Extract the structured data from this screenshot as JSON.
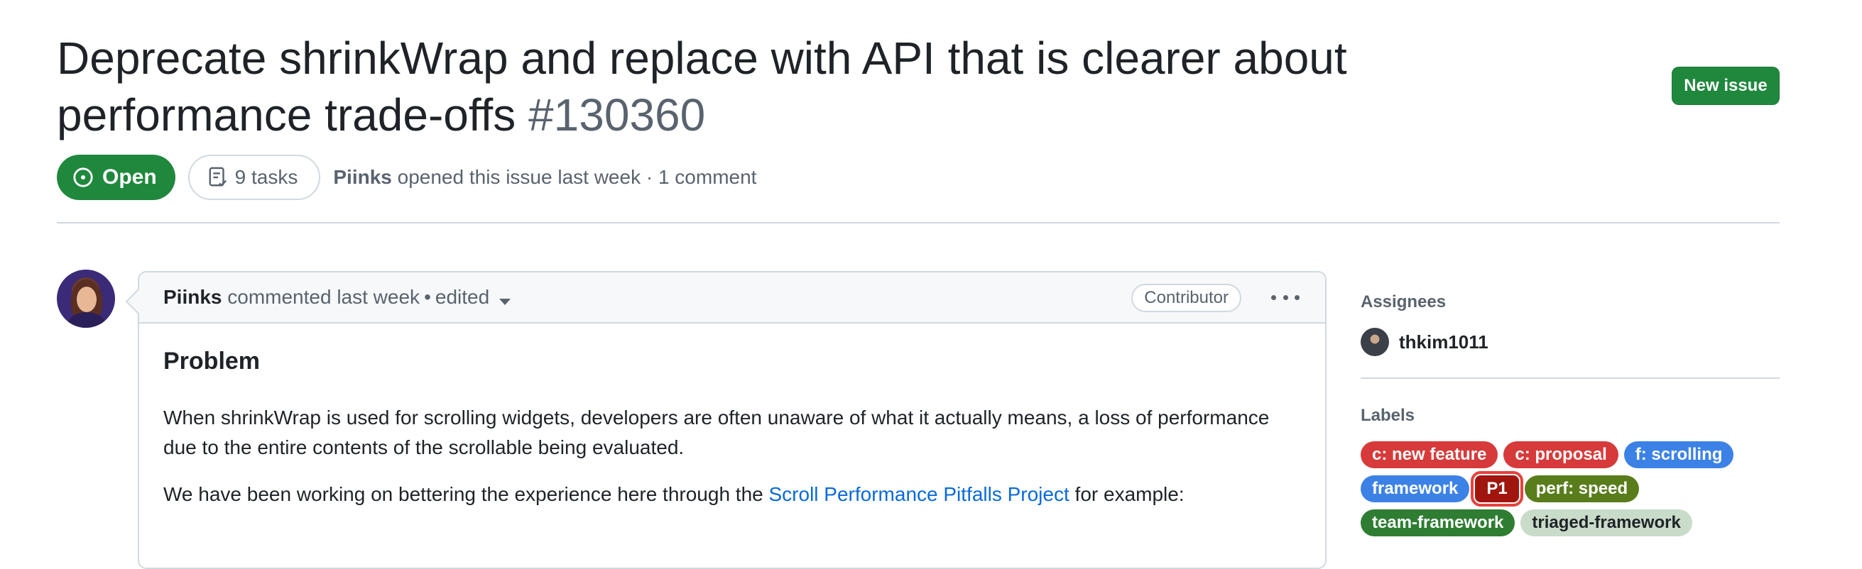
{
  "issue": {
    "title": "Deprecate shrinkWrap and replace with API that is clearer about performance trade-offs",
    "number": "#130360",
    "new_issue_label": "New issue",
    "state": "Open",
    "tasks": "9 tasks",
    "author": "Piinks",
    "opened_text": "opened this issue last week · 1 comment"
  },
  "comment": {
    "author": "Piinks",
    "when": "commented last week",
    "separator": "•",
    "edited": "edited",
    "role_badge": "Contributor",
    "heading": "Problem",
    "paragraph1": "When shrinkWrap is used for scrolling widgets, developers are often unaware of what it actually means, a loss of performance due to the entire contents of the scrollable being evaluated.",
    "paragraph2_before": "We have been working on bettering the experience here through the ",
    "paragraph2_link": "Scroll Performance Pitfalls Project",
    "paragraph2_after": " for example:"
  },
  "sidebar": {
    "assignees_heading": "Assignees",
    "assignee": "thkim1011",
    "labels_heading": "Labels",
    "labels": [
      {
        "text": "c: new feature",
        "bg": "#d73a3a",
        "fg": "#ffffff"
      },
      {
        "text": "c: proposal",
        "bg": "#d73a3a",
        "fg": "#ffffff"
      },
      {
        "text": "f: scrolling",
        "bg": "#3c82e6",
        "fg": "#ffffff"
      },
      {
        "text": "framework",
        "bg": "#3c82e6",
        "fg": "#ffffff"
      },
      {
        "text": "P1",
        "bg": "#a0160e",
        "fg": "#ffffff",
        "highlighted": true
      },
      {
        "text": "perf: speed",
        "bg": "#5a7d1c",
        "fg": "#ffffff"
      },
      {
        "text": "team-framework",
        "bg": "#2e7d32",
        "fg": "#ffffff"
      },
      {
        "text": "triaged-framework",
        "bg": "#c9dcc9",
        "fg": "#1f2328"
      }
    ]
  },
  "colors": {
    "open_green": "#1f883d",
    "link_blue": "#0969da",
    "highlight_red": "#e5423c"
  },
  "icons": {
    "state": "issue-opened-icon",
    "tasks": "checklist-icon",
    "menu": "kebab-horizontal-icon",
    "dropdown": "triangle-down-icon"
  }
}
